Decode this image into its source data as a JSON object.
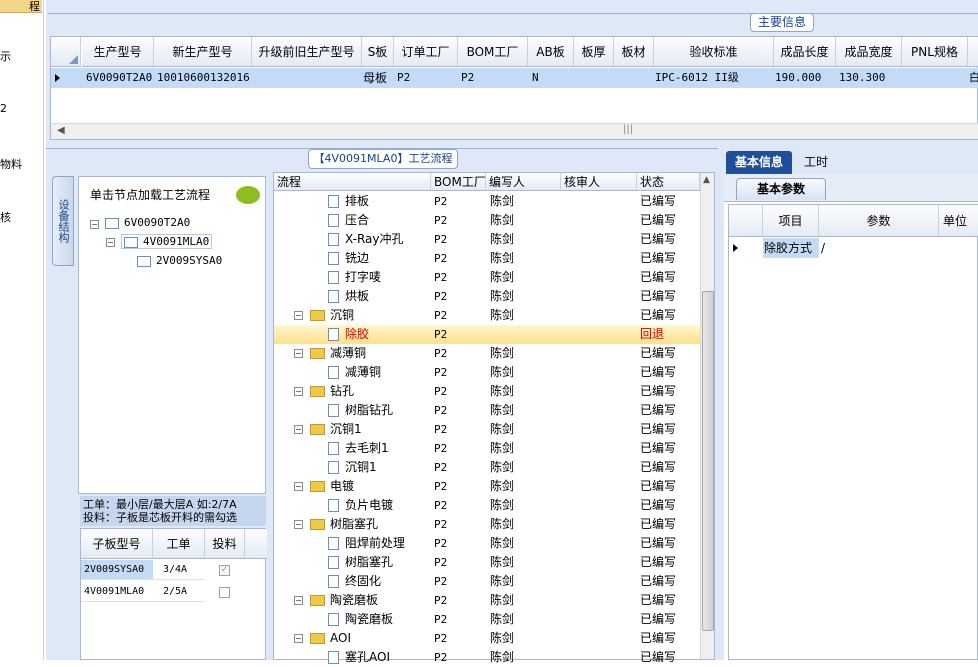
{
  "left_nav": {
    "items": [
      "程",
      "示",
      "2",
      "物料",
      "核"
    ]
  },
  "main_info": {
    "tab_label": "主要信息",
    "columns": [
      "生产型号",
      "新生产型号",
      "升级前旧生产型号",
      "S板",
      "订单工厂",
      "BOM工厂",
      "AB板",
      "板厚",
      "板材",
      "验收标准",
      "成品长度",
      "成品宽度",
      "PNL规格"
    ],
    "row": {
      "生产型号": "6V0090T2A0",
      "新生产型号": "10010600132016",
      "升级前旧生产型号": "",
      "S板": "母板",
      "订单工厂": "P2",
      "BOM工厂": "P2",
      "AB板": "N",
      "板厚": "",
      "板材": "",
      "验收标准": "IPC-6012 II级",
      "成品长度": "190.000",
      "成品宽度": "130.300",
      "PNL规格": "",
      "trail": "白"
    }
  },
  "process_tab_label": "【4V0091MLA0】工艺流程",
  "side_tab_label": "设备结构",
  "tree": {
    "hint": "单击节点加载工艺流程",
    "nodes": [
      "6V0090T2A0",
      "4V0091MLA0",
      "2V009SYSA0"
    ]
  },
  "sub_panel": {
    "label_line1": "工单：最小层/最大层A 如:2/7A",
    "label_line2": "投料：子板是芯板开料的需勾选",
    "columns": [
      "子板型号",
      "工单",
      "投料"
    ],
    "rows": [
      {
        "model": "2V009SYSA0",
        "order": "3/4A",
        "checked": true
      },
      {
        "model": "4V0091MLA0",
        "order": "2/5A",
        "checked": false
      }
    ]
  },
  "process": {
    "columns": [
      "流程",
      "BOM工厂",
      "编写人",
      "核审人",
      "状态"
    ],
    "rows": [
      {
        "type": "leaf",
        "name": "排板",
        "bom": "P2",
        "writer": "陈剑",
        "status": "已编写"
      },
      {
        "type": "leaf",
        "name": "压合",
        "bom": "P2",
        "writer": "陈剑",
        "status": "已编写"
      },
      {
        "type": "leaf",
        "name": "X-Ray冲孔",
        "bom": "P2",
        "writer": "陈剑",
        "status": "已编写"
      },
      {
        "type": "leaf",
        "name": "铣边",
        "bom": "P2",
        "writer": "陈剑",
        "status": "已编写"
      },
      {
        "type": "leaf",
        "name": "打字唛",
        "bom": "P2",
        "writer": "陈剑",
        "status": "已编写"
      },
      {
        "type": "leaf",
        "name": "烘板",
        "bom": "P2",
        "writer": "陈剑",
        "status": "已编写"
      },
      {
        "type": "folder",
        "name": "沉铜",
        "bom": "P2",
        "writer": "陈剑",
        "status": "已编写"
      },
      {
        "type": "leaf",
        "name": "除胶",
        "bom": "P2",
        "writer": "",
        "status": "回退",
        "selected": true
      },
      {
        "type": "folder",
        "name": "减薄铜",
        "bom": "P2",
        "writer": "陈剑",
        "status": "已编写"
      },
      {
        "type": "leaf",
        "name": "减薄铜",
        "bom": "P2",
        "writer": "陈剑",
        "status": "已编写"
      },
      {
        "type": "folder",
        "name": "钻孔",
        "bom": "P2",
        "writer": "陈剑",
        "status": "已编写"
      },
      {
        "type": "leaf",
        "name": "树脂钻孔",
        "bom": "P2",
        "writer": "陈剑",
        "status": "已编写"
      },
      {
        "type": "folder",
        "name": "沉铜1",
        "bom": "P2",
        "writer": "陈剑",
        "status": "已编写"
      },
      {
        "type": "leaf",
        "name": "去毛刺1",
        "bom": "P2",
        "writer": "陈剑",
        "status": "已编写"
      },
      {
        "type": "leaf",
        "name": "沉铜1",
        "bom": "P2",
        "writer": "陈剑",
        "status": "已编写"
      },
      {
        "type": "folder",
        "name": "电镀",
        "bom": "P2",
        "writer": "陈剑",
        "status": "已编写"
      },
      {
        "type": "leaf",
        "name": "负片电镀",
        "bom": "P2",
        "writer": "陈剑",
        "status": "已编写"
      },
      {
        "type": "folder",
        "name": "树脂塞孔",
        "bom": "P2",
        "writer": "陈剑",
        "status": "已编写"
      },
      {
        "type": "leaf",
        "name": "阻焊前处理",
        "bom": "P2",
        "writer": "陈剑",
        "status": "已编写"
      },
      {
        "type": "leaf",
        "name": "树脂塞孔",
        "bom": "P2",
        "writer": "陈剑",
        "status": "已编写"
      },
      {
        "type": "leaf",
        "name": "终固化",
        "bom": "P2",
        "writer": "陈剑",
        "status": "已编写"
      },
      {
        "type": "folder",
        "name": "陶瓷磨板",
        "bom": "P2",
        "writer": "陈剑",
        "status": "已编写"
      },
      {
        "type": "leaf",
        "name": "陶瓷磨板",
        "bom": "P2",
        "writer": "陈剑",
        "status": "已编写"
      },
      {
        "type": "folder",
        "name": "AOI",
        "bom": "P2",
        "writer": "陈剑",
        "status": "已编写"
      },
      {
        "type": "leaf",
        "name": "塞孔AOI",
        "bom": "P2",
        "writer": "陈剑",
        "status": "已编写"
      }
    ]
  },
  "right_panel": {
    "tabs": [
      "基本信息",
      "工时"
    ],
    "subtab": "基本参数",
    "columns": [
      "项目",
      "参数",
      "单位"
    ],
    "rows": [
      {
        "item": "除胶方式",
        "param": "/",
        "unit": ""
      }
    ]
  },
  "colors": {
    "accent": "#1f4e9a",
    "selected_row": "#c4dbf7",
    "highlight_row": "#ffe08a",
    "returned_status": "#d40000"
  }
}
